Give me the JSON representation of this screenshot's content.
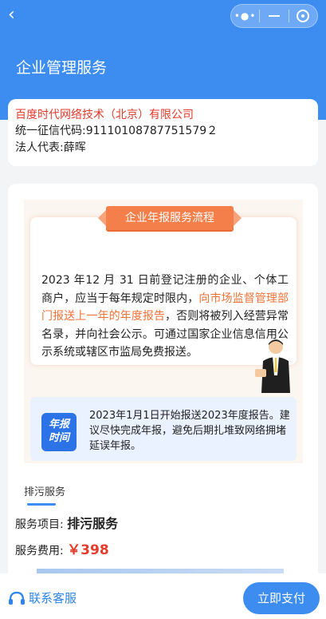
{
  "header": {
    "title": "企业管理服务",
    "back_icon": "chevron-left-icon",
    "capsule": {
      "more_icon": "more-dots-icon",
      "minimize_icon": "minus-icon",
      "close_icon": "target-icon"
    },
    "bg_color": "#3d8df0"
  },
  "company": {
    "name": "百度时代网络技术（北京）有限公司",
    "credit_code_line": "统一征信代码:91110108787751579２",
    "legal_rep_line": "法人代表:薛晖"
  },
  "poster": {
    "ribbon": "企业年报服务流程",
    "flow_text_before": "2023 年12 月 31 日前登记注册的企业、个体工商户，应当于每年规定时限内，",
    "flow_text_highlight": "向市场监督管理部门报送上一年的年度报告",
    "flow_text_after": "，否则将被列入经营异常名录，并向社会公示。可通过国家企业信息信用公示系统或辖区市监局免费报送。",
    "timing_badge_line1": "年报",
    "timing_badge_line2": "时间",
    "timing_text": "2023年1月1日开始报送2023年度报告。建议尽快完成年报，避免后期扎堆致网络拥堵延误年报。"
  },
  "service": {
    "tab_label": "排污服务",
    "item_label": "服务项目:",
    "item_value": "排污服务",
    "fee_label": "服务费用:",
    "fee_value": "￥398"
  },
  "bottom": {
    "contact_label": "联系客服",
    "contact_icon": "headset-icon",
    "pay_label": "立即支付"
  },
  "colors": {
    "accent": "#3d8df0",
    "price": "#e33b2c",
    "highlight": "#f07237"
  }
}
